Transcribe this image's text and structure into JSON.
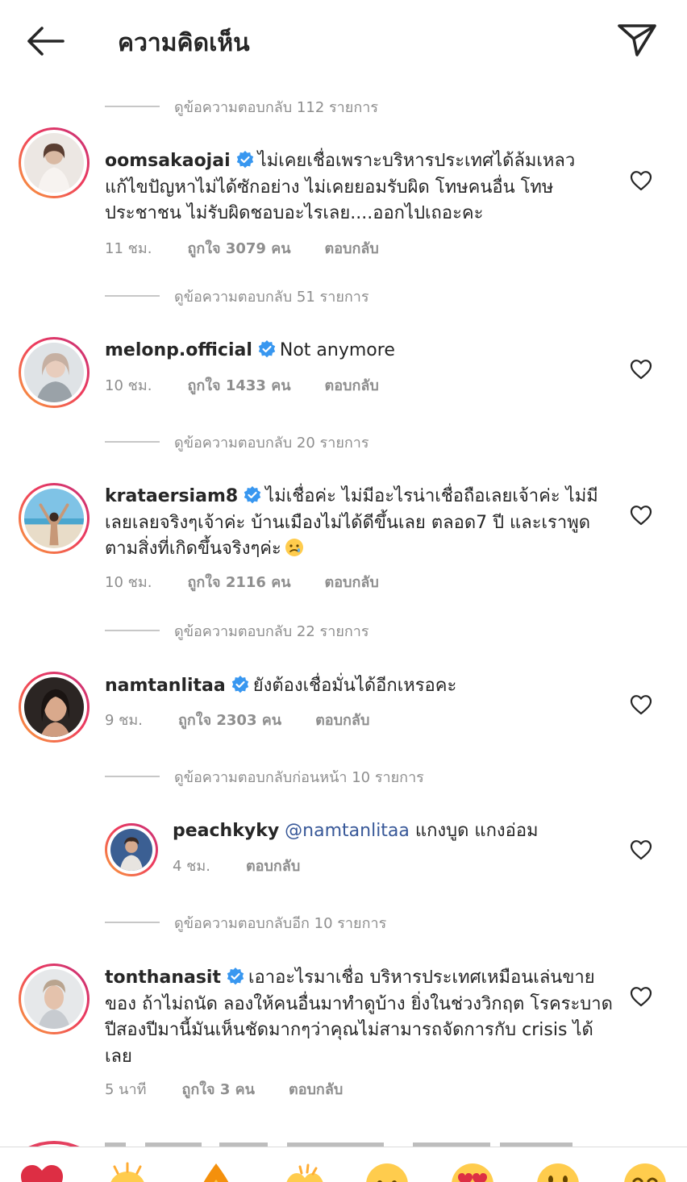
{
  "header": {
    "title": "ความคิดเห็น"
  },
  "comments": [
    {
      "view_replies": "ดูข้อความตอบกลับ 112 รายการ",
      "username": "oomsakaojai",
      "verified": true,
      "text": "ไม่เคยเชื่อเพราะบริหารประเทศได้ล้มเหลว แก้ไขปัญหาไม่ได้ซักอย่าง ไม่เคยยอมรับผิด โทษคนอื่น โทษประชาชน ไม่รับผิดชอบอะไรเลย....ออกไปเถอะคะ",
      "time": "11 ชม.",
      "likes": "ถูกใจ 3079 คน",
      "reply_label": "ตอบกลับ"
    },
    {
      "view_replies": "ดูข้อความตอบกลับ 51 รายการ",
      "username": "melonp.official",
      "verified": true,
      "text": "Not anymore",
      "time": "10 ชม.",
      "likes": "ถูกใจ 1433 คน",
      "reply_label": "ตอบกลับ"
    },
    {
      "view_replies": "ดูข้อความตอบกลับ 20 รายการ",
      "username": "krataersiam8",
      "verified": true,
      "text": "ไม่เชื่อค่ะ  ไม่มีอะไรน่าเชื่อถือเลยเจ้าค่ะ  ไม่มีเลยเลยจริงๆเจ้าค่ะ  บ้านเมืองไม่ได้ดีขึ้นเลย ตลอด7 ปี และเราพูดตามสิ่งที่เกิดขึ้นจริงๆค่ะ",
      "time": "10 ชม.",
      "likes": "ถูกใจ 2116 คน",
      "reply_label": "ตอบกลับ"
    },
    {
      "view_replies": "ดูข้อความตอบกลับ 22 รายการ",
      "username": "namtanlitaa",
      "verified": true,
      "text": "ยังต้องเชื่อมั่นได้อีกเหรอคะ",
      "time": "9 ชม.",
      "likes": "ถูกใจ 2303 คน",
      "reply_label": "ตอบกลับ"
    },
    {
      "view_replies": "ดูข้อความตอบกลับก่อนหน้า 10 รายการ",
      "username": "peachkyky",
      "verified": false,
      "mention": "@namtanlitaa",
      "text": "แกงบูด แกงอ่อม",
      "time": "4 ชม.",
      "reply_label": "ตอบกลับ"
    },
    {
      "view_replies": "ดูข้อความตอบกลับอีก 10 รายการ",
      "username": "tonthanasit",
      "verified": true,
      "text": "เอาอะไรมาเชื่อ บริหารประเทศเหมือนเล่นขายของ ถ้าไม่ถนัด ลองให้คนอื่นมาทำดูบ้าง ยิ่งในช่วงวิกฤต โรคระบาดปีสองปีมานี้มันเห็นชัดมากๆว่าคุณไม่สามารถจัดการกับ crisis ได้เลย",
      "time": "5 นาที",
      "likes": "ถูกใจ 3 คน",
      "reply_label": "ตอบกลับ"
    }
  ],
  "emoji_bar": [
    "red-heart",
    "clapping-hands",
    "fire",
    "raising-hands",
    "crying-face",
    "heart-eyes-face",
    "grinning-face",
    "smiling-face"
  ],
  "colors": {
    "text": "#262626",
    "secondary": "#8e8e8e",
    "verified": "#3897f0",
    "mention": "#385898"
  }
}
